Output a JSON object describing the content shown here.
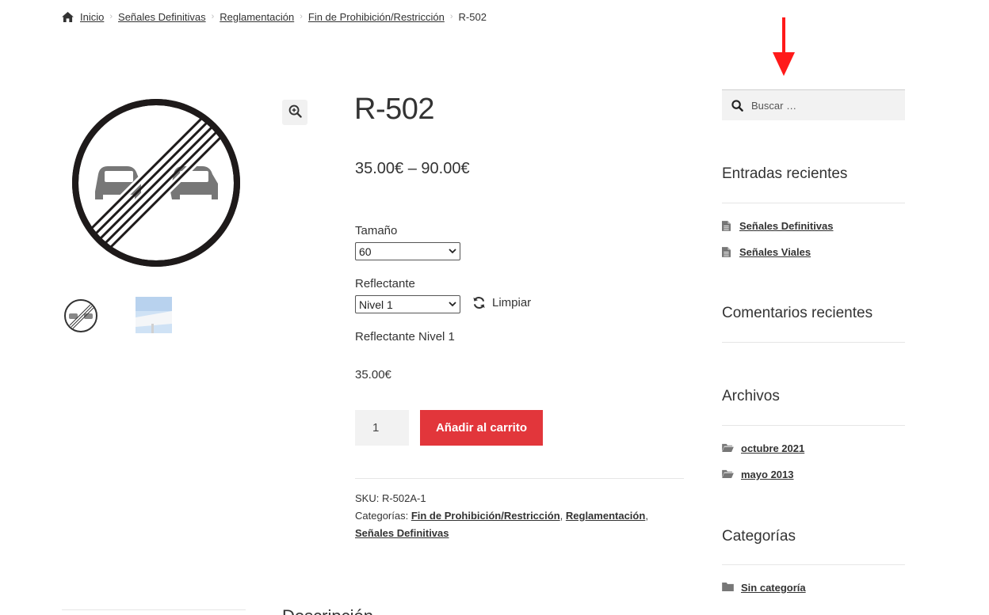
{
  "breadcrumb": {
    "home": "Inicio",
    "items": [
      "Señales Definitivas",
      "Reglamentación",
      "Fin de Prohibición/Restricción"
    ],
    "current": "R-502"
  },
  "product": {
    "title": "R-502",
    "price_range": "35.00€ – 90.00€",
    "size_label": "Tamaño",
    "size_selected": "60",
    "reflect_label": "Reflectante",
    "reflect_selected": "Nivel 1",
    "reset_label": "Limpiar",
    "variation_description": "Reflectante Nivel 1",
    "variation_price": "35.00€",
    "quantity": "1",
    "add_to_cart": "Añadir al carrito",
    "sku_label": "SKU:",
    "sku": "R-502A-1",
    "categories_label": "Categorías:",
    "categories": [
      "Fin de Prohibición/Restricción",
      "Reglamentación",
      "Señales Definitivas"
    ],
    "category_separator": ","
  },
  "icons": {
    "home": "home-icon",
    "zoom": "zoom-in-icon",
    "refresh": "refresh-icon",
    "search": "search-icon",
    "post": "document-icon",
    "folder": "folder-icon"
  },
  "colors": {
    "accent": "#e2363b",
    "annotation_arrow": "#ff1a1a"
  },
  "sidebar": {
    "search_placeholder": "Buscar …",
    "recent_posts_title": "Entradas recientes",
    "recent_posts": [
      "Señales Definitivas",
      "Señales Viales"
    ],
    "recent_comments_title": "Comentarios recientes",
    "archives_title": "Archivos",
    "archives": [
      "octubre 2021",
      "mayo 2013"
    ],
    "categories_title": "Categorías",
    "categories": [
      "Sin categoría"
    ]
  },
  "tabs": {
    "description_title": "Descripción"
  }
}
